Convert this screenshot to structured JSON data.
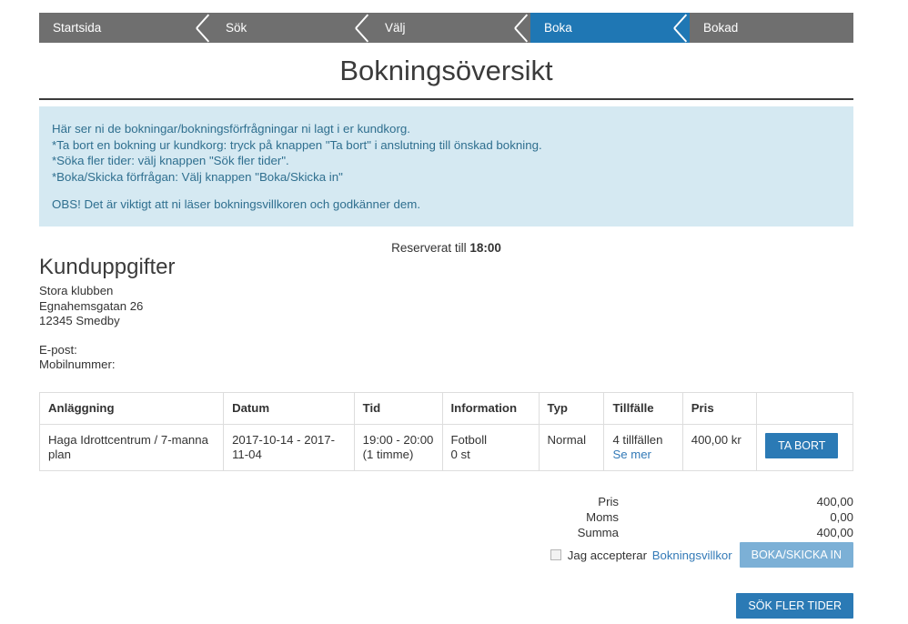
{
  "steps": [
    {
      "label": "Startsida",
      "active": false
    },
    {
      "label": "Sök",
      "active": false
    },
    {
      "label": "Välj",
      "active": false
    },
    {
      "label": "Boka",
      "active": true
    },
    {
      "label": "Bokad",
      "active": false
    }
  ],
  "page": {
    "title": "Bokningsöversikt"
  },
  "info_box": {
    "lines": [
      "Här ser ni de bokningar/bokningsförfrågningar ni lagt i er kundkorg.",
      "*Ta bort en bokning ur kundkorg: tryck på knappen \"Ta bort\" i anslutning till önskad bokning.",
      "*Söka fler tider: välj knappen \"Sök fler tider\".",
      "*Boka/Skicka förfrågan: Välj knappen \"Boka/Skicka in\""
    ],
    "note": "OBS! Det är viktigt att ni läser bokningsvillkoren och godkänner dem."
  },
  "reservation": {
    "prefix": "Reserverat till",
    "time": "18:00"
  },
  "customer": {
    "heading": "Kunduppgifter",
    "name": "Stora klubben",
    "street": "Egnahemsgatan 26",
    "city": "12345 Smedby",
    "email_label": "E-post:",
    "mobile_label": "Mobilnummer:"
  },
  "table": {
    "headers": [
      "Anläggning",
      "Datum",
      "Tid",
      "Information",
      "Typ",
      "Tillfälle",
      "Pris",
      ""
    ],
    "rows": [
      {
        "anlaggning": "Haga Idrottcentrum / 7-manna plan",
        "datum": "2017-10-14 - 2017-11-04",
        "tid_line1": "19:00 - 20:00",
        "tid_line2": "(1 timme)",
        "info_line1": "Fotboll",
        "info_line2": "0 st",
        "typ": "Normal",
        "tillfalle": "4 tillfällen",
        "tillfalle_link": "Se mer",
        "pris": "400,00 kr",
        "remove_label": "TA BORT"
      }
    ]
  },
  "summary": {
    "rows": [
      {
        "label": "Pris",
        "value": "400,00"
      },
      {
        "label": "Moms",
        "value": "0,00"
      },
      {
        "label": "Summa",
        "value": "400,00"
      }
    ],
    "accept_text": "Jag accepterar",
    "accept_link": "Bokningsvillkor",
    "submit_label": "BOKA/SKICKA IN"
  },
  "actions": {
    "search_more_label": "SÖK FLER TIDER"
  },
  "colors": {
    "step_bar": "#6f6f6f",
    "step_active": "#1f77b4",
    "info_bg": "#d5e9f2",
    "info_text": "#2f6f8f",
    "link": "#337ab7",
    "button_primary": "#2b7ab5",
    "button_muted": "#7cb0d6"
  }
}
